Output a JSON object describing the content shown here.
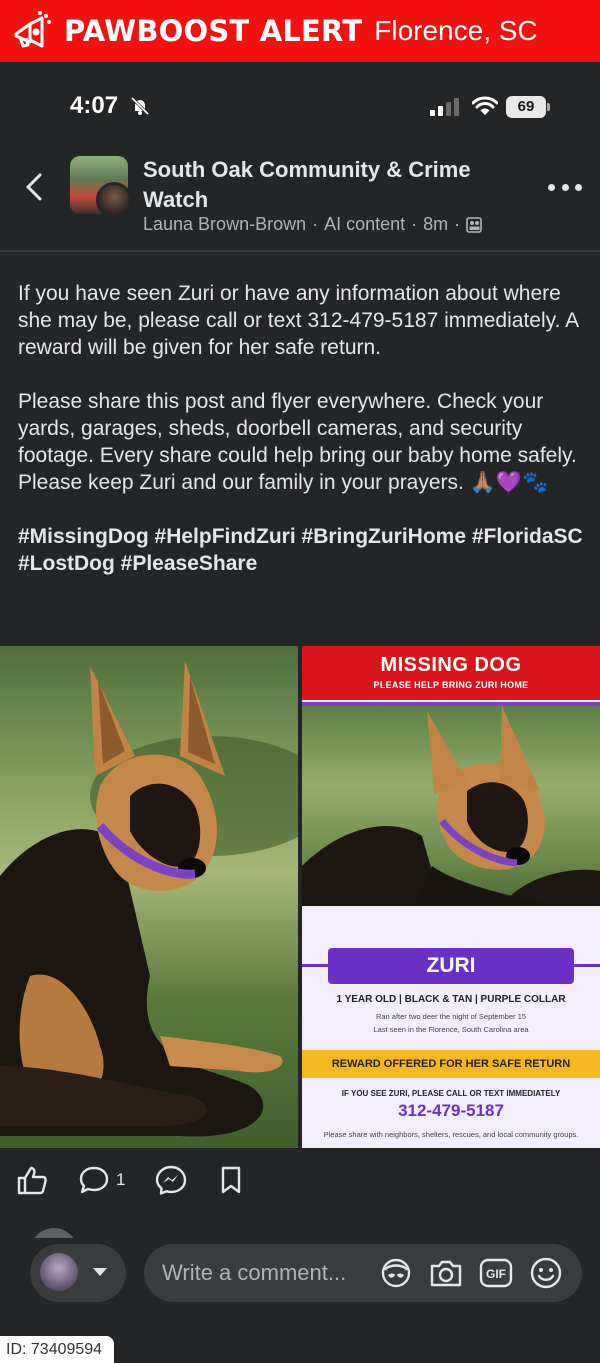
{
  "banner": {
    "brand": "PAWBOOST ALERT",
    "location": "Florence, SC",
    "logo_icon": "megaphone-paw-icon",
    "color": "#f3100f"
  },
  "status_bar": {
    "time": "4:07",
    "battery": "69"
  },
  "post_header": {
    "group_name": "South Oak Community & Crime Watch",
    "author": "Launa Brown-Brown",
    "content_label": "AI content",
    "age": "8m"
  },
  "post": {
    "paragraph1": "If you have seen Zuri or have any information about where she may be, please call or text 312-479-5187 immediately. A reward will be given for her safe return.",
    "paragraph2": "Please share this post and flyer everywhere. Check your yards, garages, sheds, doorbell cameras, and security footage. Every share could help bring our baby home safely. Please keep Zuri and our family in your prayers. 🙏🏽💜🐾",
    "hashtags": "#MissingDog #HelpFindZuri #BringZuriHome #FloridaSC #LostDog #PleaseShare"
  },
  "flyer": {
    "title": "MISSING DOG",
    "subtitle": "PLEASE HELP BRING ZURI HOME",
    "name": "ZURI",
    "details": "1 YEAR OLD  |  BLACK & TAN  |  PURPLE COLLAR",
    "ran": "Ran after two deer the night of September 15",
    "last_seen": "Last seen in the Florence, South Carolina area",
    "reward": "REWARD OFFERED FOR HER SAFE RETURN",
    "call": "IF YOU SEE ZURI, PLEASE CALL OR TEXT IMMEDIATELY",
    "phone": "312-479-5187",
    "footer": "Please share with neighbors, shelters, rescues, and local community groups."
  },
  "actions": {
    "comment_count": "1"
  },
  "composer": {
    "placeholder": "Write a comment..."
  },
  "footer": {
    "id_label": "ID: 73409594"
  }
}
